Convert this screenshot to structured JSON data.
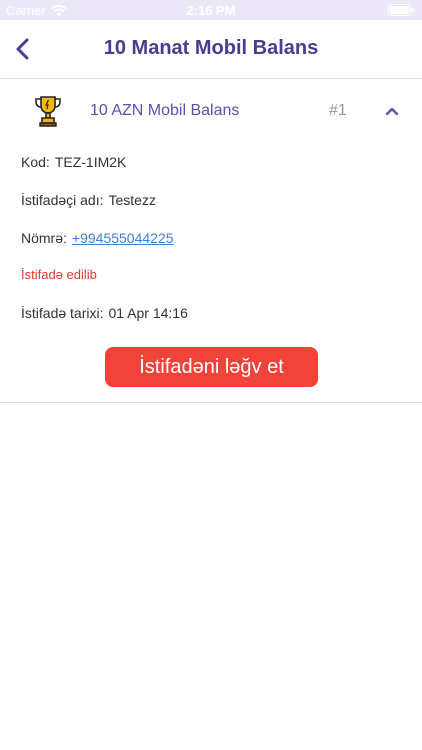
{
  "status_bar": {
    "carrier": "Carrier",
    "time": "2:16 PM"
  },
  "nav": {
    "title": "10 Manat Mobil Balans"
  },
  "card": {
    "prize_name": "10 AZN Mobil Balans",
    "rank": "#1",
    "code_label": "Kod:",
    "code_value": "TEZ-1IM2K",
    "username_label": "İstifadəçi adı:",
    "username_value": "Testezz",
    "phone_label": "Nömrə:",
    "phone_value": "+994555044225",
    "status_text": "İstifadə edilib",
    "date_label": "İstifadə tarixi:",
    "date_value": "01 Apr 14:16",
    "cancel_label": "İstifadəni ləğv et"
  },
  "colors": {
    "accent": "#4b3c8f",
    "link": "#3f7fd4",
    "danger": "#f0433a",
    "trophy": "#f5b700"
  }
}
